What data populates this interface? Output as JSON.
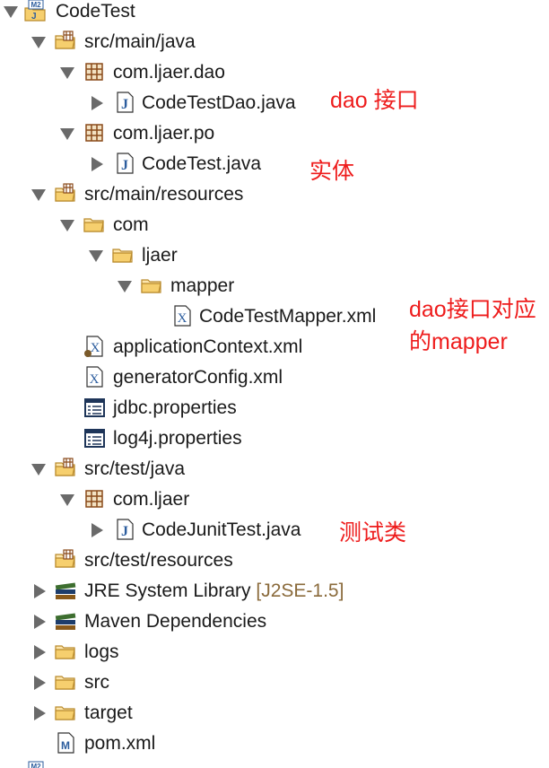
{
  "tree": {
    "project": {
      "label": "CodeTest",
      "icon": "maven-project-icon"
    },
    "src_main_java": {
      "label": "src/main/java",
      "icon": "source-folder-icon"
    },
    "pkg_dao": {
      "label": "com.ljaer.dao",
      "icon": "package-icon"
    },
    "file_dao": {
      "label": "CodeTestDao.java",
      "icon": "java-file-icon"
    },
    "pkg_po": {
      "label": "com.ljaer.po",
      "icon": "package-icon"
    },
    "file_po": {
      "label": "CodeTest.java",
      "icon": "java-file-icon"
    },
    "src_main_resources": {
      "label": "src/main/resources",
      "icon": "source-folder-icon"
    },
    "folder_com": {
      "label": "com",
      "icon": "folder-icon"
    },
    "folder_ljaer": {
      "label": "ljaer",
      "icon": "folder-icon"
    },
    "folder_mapper": {
      "label": "mapper",
      "icon": "folder-icon"
    },
    "file_mapper": {
      "label": "CodeTestMapper.xml",
      "icon": "xml-file-icon"
    },
    "file_appctx": {
      "label": "applicationContext.xml",
      "icon": "spring-xml-file-icon"
    },
    "file_gencfg": {
      "label": "generatorConfig.xml",
      "icon": "xml-file-icon"
    },
    "file_jdbc": {
      "label": "jdbc.properties",
      "icon": "properties-file-icon"
    },
    "file_log4j": {
      "label": "log4j.properties",
      "icon": "properties-file-icon"
    },
    "src_test_java": {
      "label": "src/test/java",
      "icon": "source-folder-icon"
    },
    "pkg_test": {
      "label": "com.ljaer",
      "icon": "package-icon"
    },
    "file_test": {
      "label": "CodeJunitTest.java",
      "icon": "java-file-icon"
    },
    "src_test_resources": {
      "label": "src/test/resources",
      "icon": "source-folder-icon"
    },
    "jre": {
      "label": "JRE System Library",
      "suffix": "[J2SE-1.5]",
      "icon": "library-icon"
    },
    "maven_deps": {
      "label": "Maven Dependencies",
      "icon": "library-icon"
    },
    "logs": {
      "label": "logs",
      "icon": "folder-icon"
    },
    "src": {
      "label": "src",
      "icon": "folder-icon"
    },
    "target": {
      "label": "target",
      "icon": "folder-icon"
    },
    "pom": {
      "label": "pom.xml",
      "icon": "maven-pom-icon"
    }
  },
  "annotations": {
    "dao": "dao 接口",
    "entity": "实体",
    "mapper_line1": "dao接口对应",
    "mapper_line2": "的mapper",
    "test": "测试类"
  },
  "colors": {
    "annotation": "#ee1c1c",
    "folder": "#f2c15a",
    "package": "#a8682a",
    "java": "#2c5d9e"
  }
}
